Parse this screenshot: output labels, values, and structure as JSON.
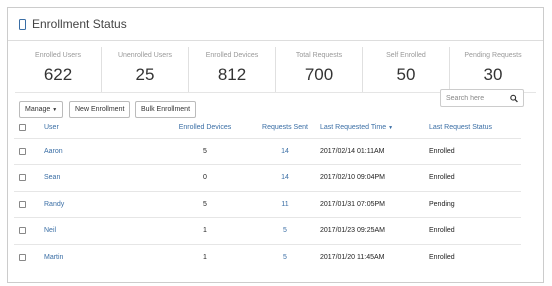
{
  "header": {
    "title": "Enrollment Status",
    "icon": "phone-icon"
  },
  "stats": [
    {
      "label": "Enrolled Users",
      "value": "622"
    },
    {
      "label": "Unenrolled Users",
      "value": "25"
    },
    {
      "label": "Enrolled Devices",
      "value": "812"
    },
    {
      "label": "Total Requests",
      "value": "700"
    },
    {
      "label": "Self Enrolled",
      "value": "50"
    },
    {
      "label": "Pending Requests",
      "value": "30"
    }
  ],
  "toolbar": {
    "manage_label": "Manage",
    "new_enrollment_label": "New Enrollment",
    "bulk_enrollment_label": "Bulk Enrollment"
  },
  "search": {
    "placeholder": "Search here"
  },
  "table": {
    "headers": [
      "User",
      "Enrolled Devices",
      "Requests Sent",
      "Last Requested Time",
      "Last Request Status"
    ],
    "sorted_column": "Last Requested Time",
    "rows": [
      {
        "user": "Aaron",
        "devices": "5",
        "requests": "14",
        "time": "2017/02/14 01:11AM",
        "status": "Enrolled"
      },
      {
        "user": "Sean",
        "devices": "0",
        "requests": "14",
        "time": "2017/02/10 09:04PM",
        "status": "Enrolled"
      },
      {
        "user": "Randy",
        "devices": "5",
        "requests": "11",
        "time": "2017/01/31 07:05PM",
        "status": "Pending"
      },
      {
        "user": "Neil",
        "devices": "1",
        "requests": "5",
        "time": "2017/01/23 09:25AM",
        "status": "Enrolled"
      },
      {
        "user": "Martin",
        "devices": "1",
        "requests": "5",
        "time": "2017/01/20 11:45AM",
        "status": "Enrolled"
      }
    ]
  },
  "colors": {
    "accent": "#3a6ea5",
    "border": "#cccccc"
  }
}
